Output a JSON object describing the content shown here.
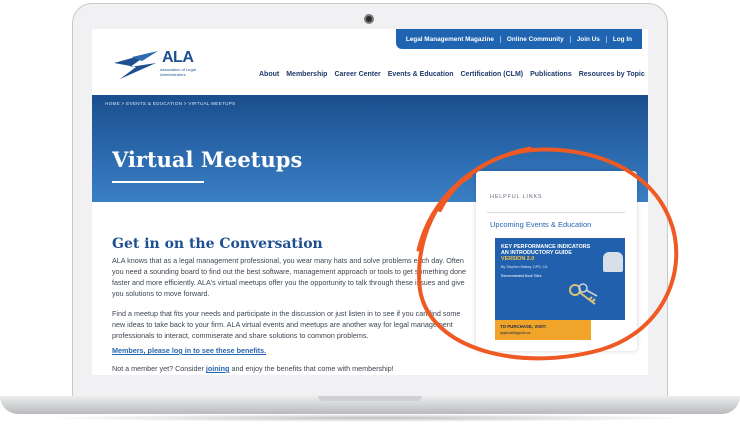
{
  "topbar": {
    "links": [
      "Legal Management Magazine",
      "Online Community",
      "Join Us",
      "Log In"
    ]
  },
  "logo": {
    "text": "ALA",
    "subtitle": "Association of Legal Administrators"
  },
  "nav": {
    "items": [
      "About",
      "Membership",
      "Career Center",
      "Events & Education",
      "Certification (CLM)",
      "Publications",
      "Resources by Topic"
    ]
  },
  "breadcrumb": "HOME  >  EVENTS & EDUCATION  >  VIRTUAL MEETUPS",
  "hero": {
    "title": "Virtual Meetups"
  },
  "content": {
    "heading": "Get in on the Conversation",
    "p1": "ALA knows that as a legal management professional, you wear many hats and solve problems each day. Often you need a sounding board to find out the best software, management approach or tools to get something done faster and more efficiently. ALA's virtual meetups offer you the opportunity to talk through these issues and give you solutions to move forward.",
    "p2": "Find a meetup that fits your needs and participate in the discussion or just listen in to see if you can find some new ideas to take back to your firm. ALA virtual events and meetups are another way for legal management professionals to interact, commiserate and share solutions to common problems.",
    "members_link": "Members, please log in to see these benefits.",
    "p3_before": "Not a member yet? Consider ",
    "p3_link": "joining",
    "p3_after": " and enjoy the benefits that come with membership!"
  },
  "sidebar": {
    "label": "HELPFUL LINKS",
    "link": "Upcoming Events & Education",
    "promo": {
      "title_line1": "KEY PERFORMANCE INDICATORS",
      "title_line2": "AN INTRODUCTORY GUIDE",
      "title_line3": "VERSION 2.0",
      "author": "By Stephen Mabey, DPS, CA",
      "blurb": "Recommended Book Titles",
      "cta": "TO PURCHASE, VISIT:",
      "cta_url": "applicabilityguide.ca"
    }
  },
  "colors": {
    "brand_blue": "#1d4f91",
    "topbar_blue": "#1f64b0",
    "link_blue": "#2966b0",
    "annotation_orange": "#ef5a24"
  }
}
